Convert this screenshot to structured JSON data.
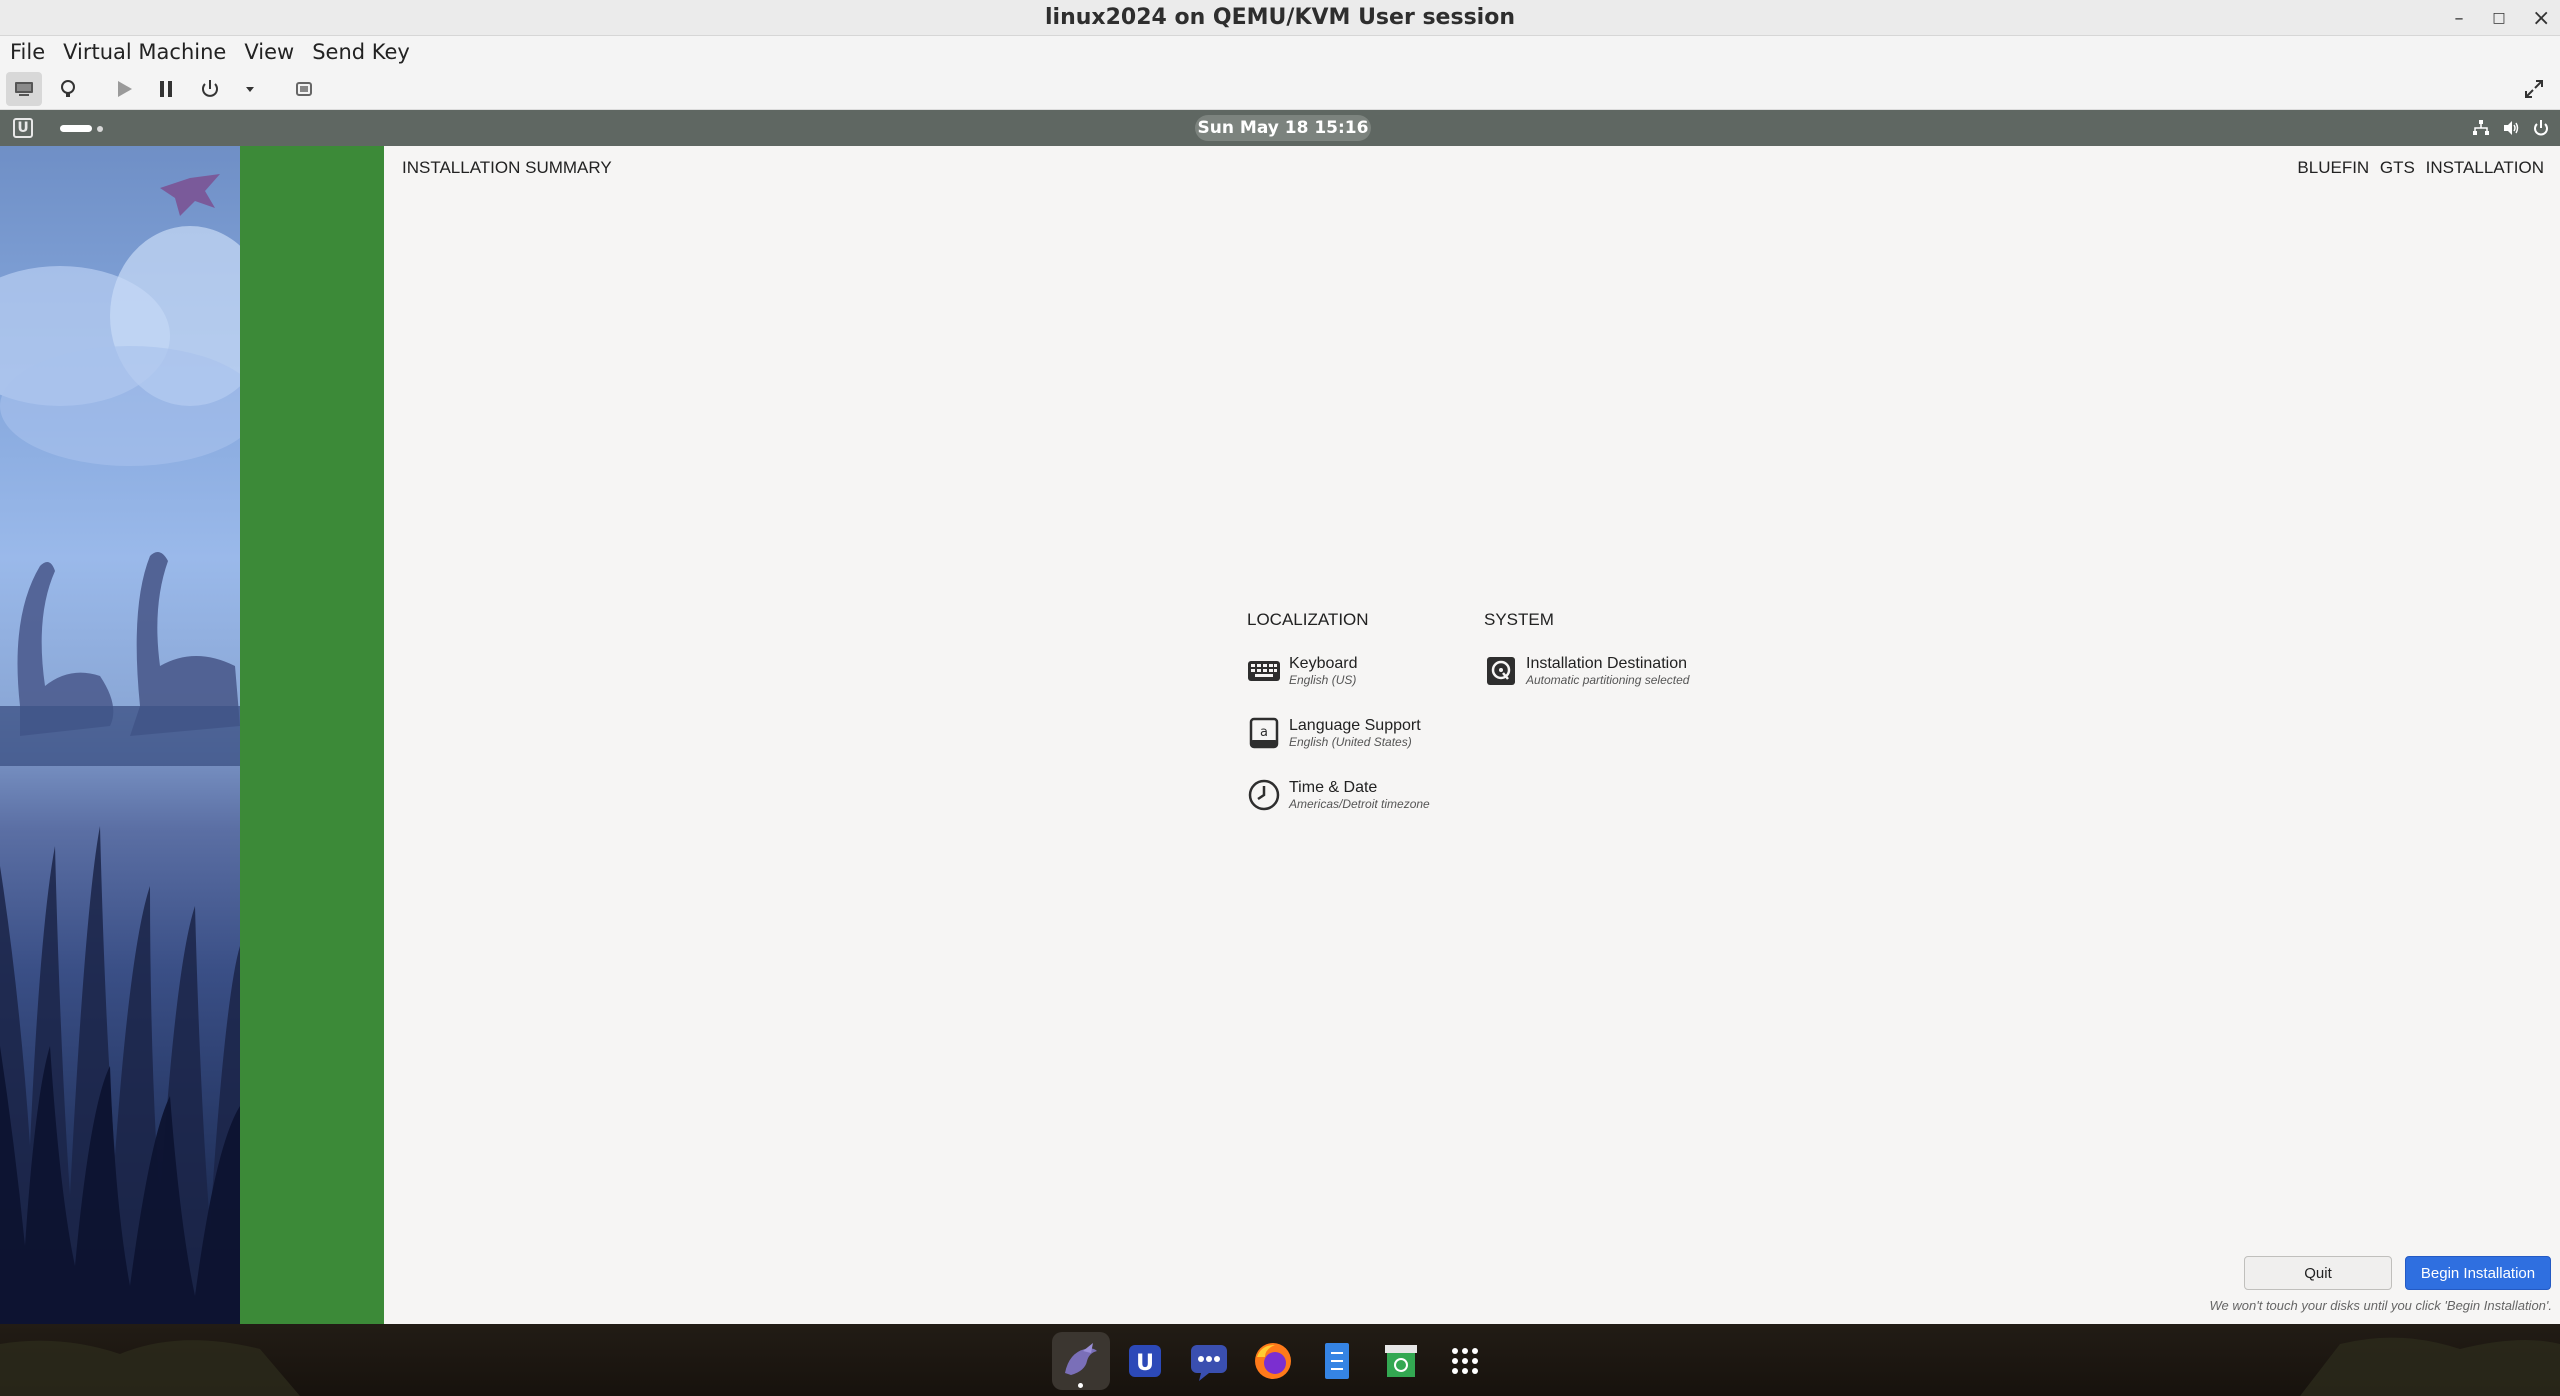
{
  "window": {
    "title": "linux2024 on QEMU/KVM User session",
    "controls": {
      "minimize": "–",
      "maximize": "□",
      "close": "×"
    }
  },
  "menubar": {
    "items": [
      "File",
      "Virtual Machine",
      "View",
      "Send Key"
    ]
  },
  "toolbar": {
    "icons": [
      "display-console-icon",
      "details-lightbulb-icon",
      "run-icon",
      "pause-icon",
      "power-icon",
      "power-menu-chevron-icon",
      "snapshots-icon",
      "fullscreen-icon"
    ]
  },
  "guest_topbar": {
    "clock": "Sun May 18  15:16",
    "logo_letter": "U"
  },
  "installer": {
    "summary_title": "INSTALLATION SUMMARY",
    "product_title": "BLUEFIN GTS INSTALLATION",
    "categories": [
      {
        "title": "LOCALIZATION",
        "spokes": [
          {
            "name": "Keyboard",
            "status": "English (US)",
            "icon": "keyboard-icon"
          },
          {
            "name": "Language Support",
            "status": "English (United States)",
            "icon": "language-icon"
          },
          {
            "name": "Time & Date",
            "status": "Americas/Detroit timezone",
            "icon": "clock-icon"
          }
        ]
      },
      {
        "title": "SYSTEM",
        "spokes": [
          {
            "name": "Installation Destination",
            "status": "Automatic partitioning selected",
            "icon": "disk-icon"
          }
        ]
      }
    ],
    "quit_label": "Quit",
    "begin_label": "Begin Installation",
    "footer_note": "We won't touch your disks until you click 'Begin Installation'."
  },
  "dock": {
    "apps": [
      "bluefin-installer-icon",
      "ublue-icon",
      "chat-icon",
      "firefox-icon",
      "files-icon",
      "software-store-icon",
      "app-grid-icon"
    ]
  },
  "colors": {
    "anaconda_sidebar": "#3c8a38",
    "begin_button": "#2f6fe0",
    "guest_topbar": "#5f6762"
  }
}
